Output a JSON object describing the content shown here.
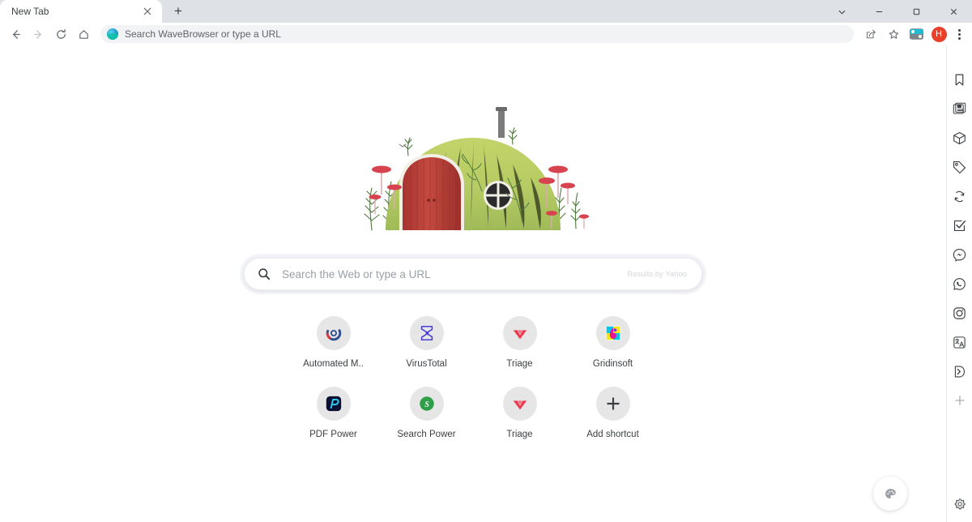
{
  "window": {
    "controls": [
      {
        "name": "minimize-to-tray",
        "glyph": "chevron-down-icon"
      },
      {
        "name": "minimize",
        "glyph": "minimize-icon"
      },
      {
        "name": "maximize",
        "glyph": "maximize-icon"
      },
      {
        "name": "close",
        "glyph": "close-icon"
      }
    ]
  },
  "tabstrip": {
    "tabs": [
      {
        "title": "New Tab",
        "close_label": "×"
      }
    ],
    "new_tab_label": "+"
  },
  "toolbar": {
    "back_title": "Back",
    "forward_title": "Forward",
    "reload_title": "Reload",
    "home_title": "Home",
    "omnibox": {
      "value": "",
      "placeholder": "Search WaveBrowser or type a URL",
      "favicon": "wavebrowser-globe-icon"
    },
    "share_title": "Share",
    "bookmark_title": "Bookmark this tab",
    "extension_title": "Extensions",
    "profile_initial": "H",
    "menu_title": "Customize and control"
  },
  "newtab": {
    "doodle_alt": "watercolor hobbit house doodle",
    "search": {
      "placeholder": "Search the Web or type a URL",
      "attribution": "Results by Yahoo",
      "icon": "search-icon"
    },
    "shortcuts": [
      {
        "label": "Automated M..",
        "icon": "automated-malware-analysis-icon"
      },
      {
        "label": "VirusTotal",
        "icon": "virustotal-sigma-icon"
      },
      {
        "label": "Triage",
        "icon": "triage-icon"
      },
      {
        "label": "Gridinsoft",
        "icon": "gridinsoft-icon"
      },
      {
        "label": "PDF Power",
        "icon": "pdf-power-icon"
      },
      {
        "label": "Search Power",
        "icon": "search-power-icon"
      },
      {
        "label": "Triage",
        "icon": "triage-icon"
      },
      {
        "label": "Add shortcut",
        "icon": "plus-icon"
      }
    ],
    "customize_title": "Customize this page"
  },
  "sidebar": {
    "items": [
      {
        "name": "bookmarks",
        "icon": "bookmark-icon"
      },
      {
        "name": "news",
        "icon": "news-feed-icon"
      },
      {
        "name": "packages",
        "icon": "package-box-icon"
      },
      {
        "name": "deals",
        "icon": "price-tag-icon"
      },
      {
        "name": "sync",
        "icon": "sync-refresh-icon"
      },
      {
        "name": "tasks",
        "icon": "checklist-icon"
      },
      {
        "name": "messenger",
        "icon": "messenger-icon"
      },
      {
        "name": "whatsapp",
        "icon": "whatsapp-icon"
      },
      {
        "name": "instagram",
        "icon": "instagram-icon"
      },
      {
        "name": "translate",
        "icon": "translate-icon"
      },
      {
        "name": "expand",
        "icon": "chevron-right-boxed-icon"
      },
      {
        "name": "add",
        "icon": "plus-icon"
      }
    ],
    "settings": {
      "name": "settings",
      "icon": "gear-icon"
    }
  },
  "colors": {
    "tabstrip_bg": "#dee1e6",
    "toolbar_bg": "#ffffff",
    "omnibox_bg": "#f1f3f4",
    "avatar_bg": "#e8402a",
    "shortcut_circle": "#e6e6e6",
    "text": "#3c4043",
    "muted": "#9aa0a6"
  }
}
